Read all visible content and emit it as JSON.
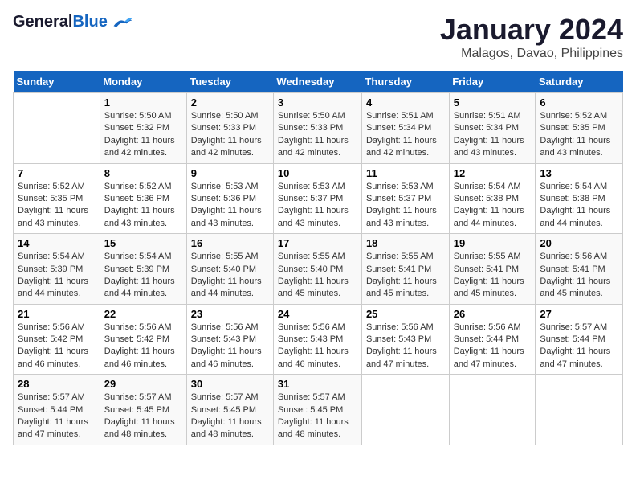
{
  "header": {
    "logo_general": "General",
    "logo_blue": "Blue",
    "title": "January 2024",
    "subtitle": "Malagos, Davao, Philippines"
  },
  "calendar": {
    "days_of_week": [
      "Sunday",
      "Monday",
      "Tuesday",
      "Wednesday",
      "Thursday",
      "Friday",
      "Saturday"
    ],
    "weeks": [
      [
        {
          "day": "",
          "info": ""
        },
        {
          "day": "1",
          "info": "Sunrise: 5:50 AM\nSunset: 5:32 PM\nDaylight: 11 hours\nand 42 minutes."
        },
        {
          "day": "2",
          "info": "Sunrise: 5:50 AM\nSunset: 5:33 PM\nDaylight: 11 hours\nand 42 minutes."
        },
        {
          "day": "3",
          "info": "Sunrise: 5:50 AM\nSunset: 5:33 PM\nDaylight: 11 hours\nand 42 minutes."
        },
        {
          "day": "4",
          "info": "Sunrise: 5:51 AM\nSunset: 5:34 PM\nDaylight: 11 hours\nand 42 minutes."
        },
        {
          "day": "5",
          "info": "Sunrise: 5:51 AM\nSunset: 5:34 PM\nDaylight: 11 hours\nand 43 minutes."
        },
        {
          "day": "6",
          "info": "Sunrise: 5:52 AM\nSunset: 5:35 PM\nDaylight: 11 hours\nand 43 minutes."
        }
      ],
      [
        {
          "day": "7",
          "info": "Sunrise: 5:52 AM\nSunset: 5:35 PM\nDaylight: 11 hours\nand 43 minutes."
        },
        {
          "day": "8",
          "info": "Sunrise: 5:52 AM\nSunset: 5:36 PM\nDaylight: 11 hours\nand 43 minutes."
        },
        {
          "day": "9",
          "info": "Sunrise: 5:53 AM\nSunset: 5:36 PM\nDaylight: 11 hours\nand 43 minutes."
        },
        {
          "day": "10",
          "info": "Sunrise: 5:53 AM\nSunset: 5:37 PM\nDaylight: 11 hours\nand 43 minutes."
        },
        {
          "day": "11",
          "info": "Sunrise: 5:53 AM\nSunset: 5:37 PM\nDaylight: 11 hours\nand 43 minutes."
        },
        {
          "day": "12",
          "info": "Sunrise: 5:54 AM\nSunset: 5:38 PM\nDaylight: 11 hours\nand 44 minutes."
        },
        {
          "day": "13",
          "info": "Sunrise: 5:54 AM\nSunset: 5:38 PM\nDaylight: 11 hours\nand 44 minutes."
        }
      ],
      [
        {
          "day": "14",
          "info": "Sunrise: 5:54 AM\nSunset: 5:39 PM\nDaylight: 11 hours\nand 44 minutes."
        },
        {
          "day": "15",
          "info": "Sunrise: 5:54 AM\nSunset: 5:39 PM\nDaylight: 11 hours\nand 44 minutes."
        },
        {
          "day": "16",
          "info": "Sunrise: 5:55 AM\nSunset: 5:40 PM\nDaylight: 11 hours\nand 44 minutes."
        },
        {
          "day": "17",
          "info": "Sunrise: 5:55 AM\nSunset: 5:40 PM\nDaylight: 11 hours\nand 45 minutes."
        },
        {
          "day": "18",
          "info": "Sunrise: 5:55 AM\nSunset: 5:41 PM\nDaylight: 11 hours\nand 45 minutes."
        },
        {
          "day": "19",
          "info": "Sunrise: 5:55 AM\nSunset: 5:41 PM\nDaylight: 11 hours\nand 45 minutes."
        },
        {
          "day": "20",
          "info": "Sunrise: 5:56 AM\nSunset: 5:41 PM\nDaylight: 11 hours\nand 45 minutes."
        }
      ],
      [
        {
          "day": "21",
          "info": "Sunrise: 5:56 AM\nSunset: 5:42 PM\nDaylight: 11 hours\nand 46 minutes."
        },
        {
          "day": "22",
          "info": "Sunrise: 5:56 AM\nSunset: 5:42 PM\nDaylight: 11 hours\nand 46 minutes."
        },
        {
          "day": "23",
          "info": "Sunrise: 5:56 AM\nSunset: 5:43 PM\nDaylight: 11 hours\nand 46 minutes."
        },
        {
          "day": "24",
          "info": "Sunrise: 5:56 AM\nSunset: 5:43 PM\nDaylight: 11 hours\nand 46 minutes."
        },
        {
          "day": "25",
          "info": "Sunrise: 5:56 AM\nSunset: 5:43 PM\nDaylight: 11 hours\nand 47 minutes."
        },
        {
          "day": "26",
          "info": "Sunrise: 5:56 AM\nSunset: 5:44 PM\nDaylight: 11 hours\nand 47 minutes."
        },
        {
          "day": "27",
          "info": "Sunrise: 5:57 AM\nSunset: 5:44 PM\nDaylight: 11 hours\nand 47 minutes."
        }
      ],
      [
        {
          "day": "28",
          "info": "Sunrise: 5:57 AM\nSunset: 5:44 PM\nDaylight: 11 hours\nand 47 minutes."
        },
        {
          "day": "29",
          "info": "Sunrise: 5:57 AM\nSunset: 5:45 PM\nDaylight: 11 hours\nand 48 minutes."
        },
        {
          "day": "30",
          "info": "Sunrise: 5:57 AM\nSunset: 5:45 PM\nDaylight: 11 hours\nand 48 minutes."
        },
        {
          "day": "31",
          "info": "Sunrise: 5:57 AM\nSunset: 5:45 PM\nDaylight: 11 hours\nand 48 minutes."
        },
        {
          "day": "",
          "info": ""
        },
        {
          "day": "",
          "info": ""
        },
        {
          "day": "",
          "info": ""
        }
      ]
    ]
  }
}
